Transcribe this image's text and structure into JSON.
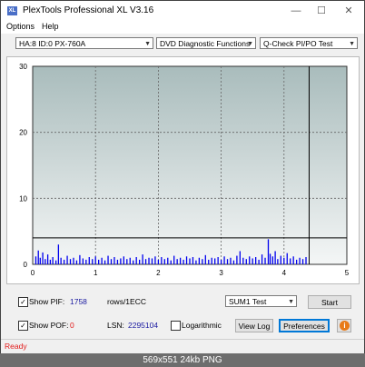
{
  "window": {
    "title": "PlexTools Professional XL V3.16",
    "icon_label": "XL",
    "minimize_icon": "minimize-icon",
    "maximize_icon": "maximize-icon",
    "close_icon": "close-icon",
    "minimize_glyph": "—",
    "maximize_glyph": "☐",
    "close_glyph": "✕"
  },
  "menu": {
    "items": [
      "Options",
      "Help"
    ]
  },
  "toolbar": {
    "drive": "HA:8 ID:0  PX-760A",
    "function": "DVD Diagnostic Functions",
    "test": "Q-Check PI/PO Test"
  },
  "chart_data": {
    "type": "bar",
    "xlim": [
      0,
      5
    ],
    "ylim": [
      0,
      30
    ],
    "xticks": [
      "0",
      "1",
      "2",
      "3",
      "4",
      "5"
    ],
    "yticks": [
      "0",
      "10",
      "20",
      "30"
    ],
    "threshold_line": 4,
    "end_marker_x": 4.4,
    "bar_color": "#0000ee",
    "grid": true,
    "bars": [
      {
        "x": 0.05,
        "y": 1.2
      },
      {
        "x": 0.09,
        "y": 2.1
      },
      {
        "x": 0.12,
        "y": 1.0
      },
      {
        "x": 0.16,
        "y": 1.8
      },
      {
        "x": 0.2,
        "y": 0.8
      },
      {
        "x": 0.24,
        "y": 1.5
      },
      {
        "x": 0.28,
        "y": 0.7
      },
      {
        "x": 0.32,
        "y": 1.1
      },
      {
        "x": 0.37,
        "y": 0.6
      },
      {
        "x": 0.41,
        "y": 3.0
      },
      {
        "x": 0.45,
        "y": 1.0
      },
      {
        "x": 0.5,
        "y": 0.7
      },
      {
        "x": 0.55,
        "y": 1.3
      },
      {
        "x": 0.6,
        "y": 0.8
      },
      {
        "x": 0.65,
        "y": 1.0
      },
      {
        "x": 0.7,
        "y": 0.6
      },
      {
        "x": 0.75,
        "y": 1.4
      },
      {
        "x": 0.8,
        "y": 0.9
      },
      {
        "x": 0.85,
        "y": 0.7
      },
      {
        "x": 0.9,
        "y": 1.1
      },
      {
        "x": 0.95,
        "y": 0.8
      },
      {
        "x": 1.0,
        "y": 1.2
      },
      {
        "x": 1.05,
        "y": 0.7
      },
      {
        "x": 1.1,
        "y": 1.0
      },
      {
        "x": 1.15,
        "y": 0.6
      },
      {
        "x": 1.2,
        "y": 1.3
      },
      {
        "x": 1.25,
        "y": 0.8
      },
      {
        "x": 1.3,
        "y": 1.1
      },
      {
        "x": 1.35,
        "y": 0.7
      },
      {
        "x": 1.4,
        "y": 0.9
      },
      {
        "x": 1.45,
        "y": 1.2
      },
      {
        "x": 1.5,
        "y": 0.8
      },
      {
        "x": 1.55,
        "y": 1.0
      },
      {
        "x": 1.6,
        "y": 0.6
      },
      {
        "x": 1.65,
        "y": 1.1
      },
      {
        "x": 1.7,
        "y": 0.7
      },
      {
        "x": 1.75,
        "y": 1.5
      },
      {
        "x": 1.8,
        "y": 0.8
      },
      {
        "x": 1.85,
        "y": 1.0
      },
      {
        "x": 1.9,
        "y": 0.9
      },
      {
        "x": 1.95,
        "y": 1.2
      },
      {
        "x": 2.0,
        "y": 0.7
      },
      {
        "x": 2.05,
        "y": 1.1
      },
      {
        "x": 2.1,
        "y": 0.8
      },
      {
        "x": 2.15,
        "y": 1.0
      },
      {
        "x": 2.2,
        "y": 0.6
      },
      {
        "x": 2.25,
        "y": 1.3
      },
      {
        "x": 2.3,
        "y": 0.8
      },
      {
        "x": 2.35,
        "y": 1.0
      },
      {
        "x": 2.4,
        "y": 0.7
      },
      {
        "x": 2.45,
        "y": 1.2
      },
      {
        "x": 2.5,
        "y": 0.9
      },
      {
        "x": 2.55,
        "y": 1.1
      },
      {
        "x": 2.6,
        "y": 0.6
      },
      {
        "x": 2.65,
        "y": 1.0
      },
      {
        "x": 2.7,
        "y": 0.8
      },
      {
        "x": 2.75,
        "y": 1.4
      },
      {
        "x": 2.8,
        "y": 0.7
      },
      {
        "x": 2.85,
        "y": 1.0
      },
      {
        "x": 2.9,
        "y": 0.9
      },
      {
        "x": 2.95,
        "y": 1.1
      },
      {
        "x": 3.0,
        "y": 0.7
      },
      {
        "x": 3.05,
        "y": 1.2
      },
      {
        "x": 3.1,
        "y": 0.8
      },
      {
        "x": 3.15,
        "y": 1.0
      },
      {
        "x": 3.2,
        "y": 0.6
      },
      {
        "x": 3.25,
        "y": 1.3
      },
      {
        "x": 3.3,
        "y": 2.0
      },
      {
        "x": 3.35,
        "y": 1.0
      },
      {
        "x": 3.4,
        "y": 0.8
      },
      {
        "x": 3.45,
        "y": 1.2
      },
      {
        "x": 3.5,
        "y": 0.9
      },
      {
        "x": 3.55,
        "y": 1.1
      },
      {
        "x": 3.6,
        "y": 0.7
      },
      {
        "x": 3.65,
        "y": 1.5
      },
      {
        "x": 3.7,
        "y": 1.0
      },
      {
        "x": 3.75,
        "y": 3.8
      },
      {
        "x": 3.78,
        "y": 1.6
      },
      {
        "x": 3.82,
        "y": 1.2
      },
      {
        "x": 3.86,
        "y": 2.0
      },
      {
        "x": 3.9,
        "y": 0.8
      },
      {
        "x": 3.95,
        "y": 1.3
      },
      {
        "x": 4.0,
        "y": 1.0
      },
      {
        "x": 4.05,
        "y": 1.7
      },
      {
        "x": 4.1,
        "y": 0.9
      },
      {
        "x": 4.15,
        "y": 1.2
      },
      {
        "x": 4.2,
        "y": 0.7
      },
      {
        "x": 4.25,
        "y": 1.0
      },
      {
        "x": 4.3,
        "y": 0.8
      },
      {
        "x": 4.35,
        "y": 1.1
      }
    ]
  },
  "controls": {
    "show_pif_label": "Show PIF:",
    "pif_value": "1758",
    "pif_unit": "rows/1ECC",
    "show_pof_label": "Show POF:",
    "pof_value": "0",
    "lsn_label": "LSN:",
    "lsn_value": "2295104",
    "logarithmic_label": "Logarithmic",
    "sum_select": "SUM1 Test",
    "start_label": "Start",
    "view_log_label": "View Log",
    "preferences_label": "Preferences",
    "info_glyph": "i",
    "check_glyph": "✓"
  },
  "status": {
    "text": "Ready"
  },
  "caption": {
    "text": "569x551  24kb  PNG"
  }
}
